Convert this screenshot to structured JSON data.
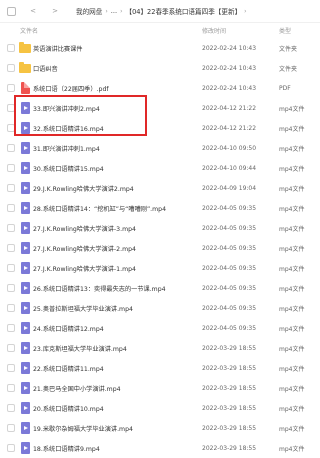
{
  "breadcrumb": {
    "root": "我的网盘",
    "ellipsis": "...",
    "current": "【04】22春季系统口语篇四季【更新】"
  },
  "columns": {
    "name": "文件名",
    "date": "修改时间",
    "type": "类型"
  },
  "files": [
    {
      "name": "英语演讲比赛课件",
      "date": "2022-02-24 10:43",
      "type": "文件夹",
      "icon": "folder-icon"
    },
    {
      "name": "口语纠音",
      "date": "2022-02-24 10:43",
      "type": "文件夹",
      "icon": "folder-icon"
    },
    {
      "name": "系统口语（22届四季）.pdf",
      "date": "2022-02-24 10:43",
      "type": "PDF",
      "icon": "pdf-icon"
    },
    {
      "name": "33.即兴演讲冲刺2.mp4",
      "date": "2022-04-12 21:22",
      "type": "mp4文件",
      "icon": "mp4-icon"
    },
    {
      "name": "32.系统口语精讲16.mp4",
      "date": "2022-04-12 21:22",
      "type": "mp4文件",
      "icon": "mp4-icon"
    },
    {
      "name": "31.即兴演讲冲刺1.mp4",
      "date": "2022-04-10 09:50",
      "type": "mp4文件",
      "icon": "mp4-icon"
    },
    {
      "name": "30.系统口语精讲15.mp4",
      "date": "2022-04-10 09:44",
      "type": "mp4文件",
      "icon": "mp4-icon"
    },
    {
      "name": "29.J.K.Rowling哈佛大学演讲2.mp4",
      "date": "2022-04-09 19:04",
      "type": "mp4文件",
      "icon": "mp4-icon"
    },
    {
      "name": "28.系统口语精讲14：“挖机缸”与“嘈嘈刚”.mp4",
      "date": "2022-04-05 09:35",
      "type": "mp4文件",
      "icon": "mp4-icon"
    },
    {
      "name": "27.J.K.Rowling哈佛大学演讲-3.mp4",
      "date": "2022-04-05 09:35",
      "type": "mp4文件",
      "icon": "mp4-icon"
    },
    {
      "name": "27.J.K.Rowling哈佛大学演讲-2.mp4",
      "date": "2022-04-05 09:35",
      "type": "mp4文件",
      "icon": "mp4-icon"
    },
    {
      "name": "27.J.K.Rowling哈佛大学演讲-1.mp4",
      "date": "2022-04-05 09:35",
      "type": "mp4文件",
      "icon": "mp4-icon"
    },
    {
      "name": "26.系统口语精讲13：奕得最失志的一节课.mp4",
      "date": "2022-04-05 09:35",
      "type": "mp4文件",
      "icon": "mp4-icon"
    },
    {
      "name": "25.奥普拉斯坦福大学毕业演讲.mp4",
      "date": "2022-04-05 09:35",
      "type": "mp4文件",
      "icon": "mp4-icon"
    },
    {
      "name": "24.系统口语精讲12.mp4",
      "date": "2022-04-05 09:35",
      "type": "mp4文件",
      "icon": "mp4-icon"
    },
    {
      "name": "23.库克斯坦福大学毕业演讲.mp4",
      "date": "2022-03-29 18:55",
      "type": "mp4文件",
      "icon": "mp4-icon"
    },
    {
      "name": "22.系统口语精讲11.mp4",
      "date": "2022-03-29 18:55",
      "type": "mp4文件",
      "icon": "mp4-icon"
    },
    {
      "name": "21.奥巴马全国中小学演讲.mp4",
      "date": "2022-03-29 18:55",
      "type": "mp4文件",
      "icon": "mp4-icon"
    },
    {
      "name": "20.系统口语精讲10.mp4",
      "date": "2022-03-29 18:55",
      "type": "mp4文件",
      "icon": "mp4-icon"
    },
    {
      "name": "19.米歇尔杂姆福大学毕业演讲.mp4",
      "date": "2022-03-29 18:55",
      "type": "mp4文件",
      "icon": "mp4-icon"
    },
    {
      "name": "18.系统口语精讲9.mp4",
      "date": "2022-03-29 18:55",
      "type": "mp4文件",
      "icon": "mp4-icon"
    }
  ]
}
